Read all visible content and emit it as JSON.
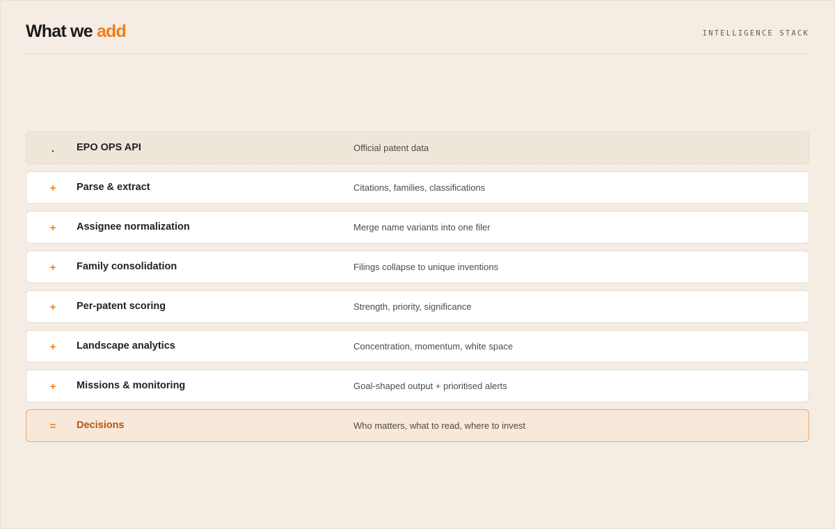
{
  "header": {
    "title_prefix": "What we",
    "title_accent": "add",
    "eyebrow": "INTELLIGENCE STACK"
  },
  "stack": [
    {
      "op": ".",
      "name": "EPO OPS API",
      "desc": "Official patent data",
      "kind": "base"
    },
    {
      "op": "+",
      "name": "Parse & extract",
      "desc": "Citations, families, classifications",
      "kind": "step"
    },
    {
      "op": "+",
      "name": "Assignee normalization",
      "desc": "Merge name variants into one filer",
      "kind": "step"
    },
    {
      "op": "+",
      "name": "Family consolidation",
      "desc": "Filings collapse to unique inventions",
      "kind": "step"
    },
    {
      "op": "+",
      "name": "Per-patent scoring",
      "desc": "Strength, priority, significance",
      "kind": "step"
    },
    {
      "op": "+",
      "name": "Landscape analytics",
      "desc": "Concentration, momentum, white space",
      "kind": "step"
    },
    {
      "op": "+",
      "name": "Missions & monitoring",
      "desc": "Goal-shaped output + prioritised alerts",
      "kind": "step"
    },
    {
      "op": "=",
      "name": "Decisions",
      "desc": "Who matters, what to read, where to invest",
      "kind": "result"
    }
  ],
  "colors": {
    "background": "#f5ede3",
    "accent": "#f07e1a",
    "result_text": "#b8560e",
    "result_fill": "#f8e8da",
    "result_border": "#f0a866"
  }
}
